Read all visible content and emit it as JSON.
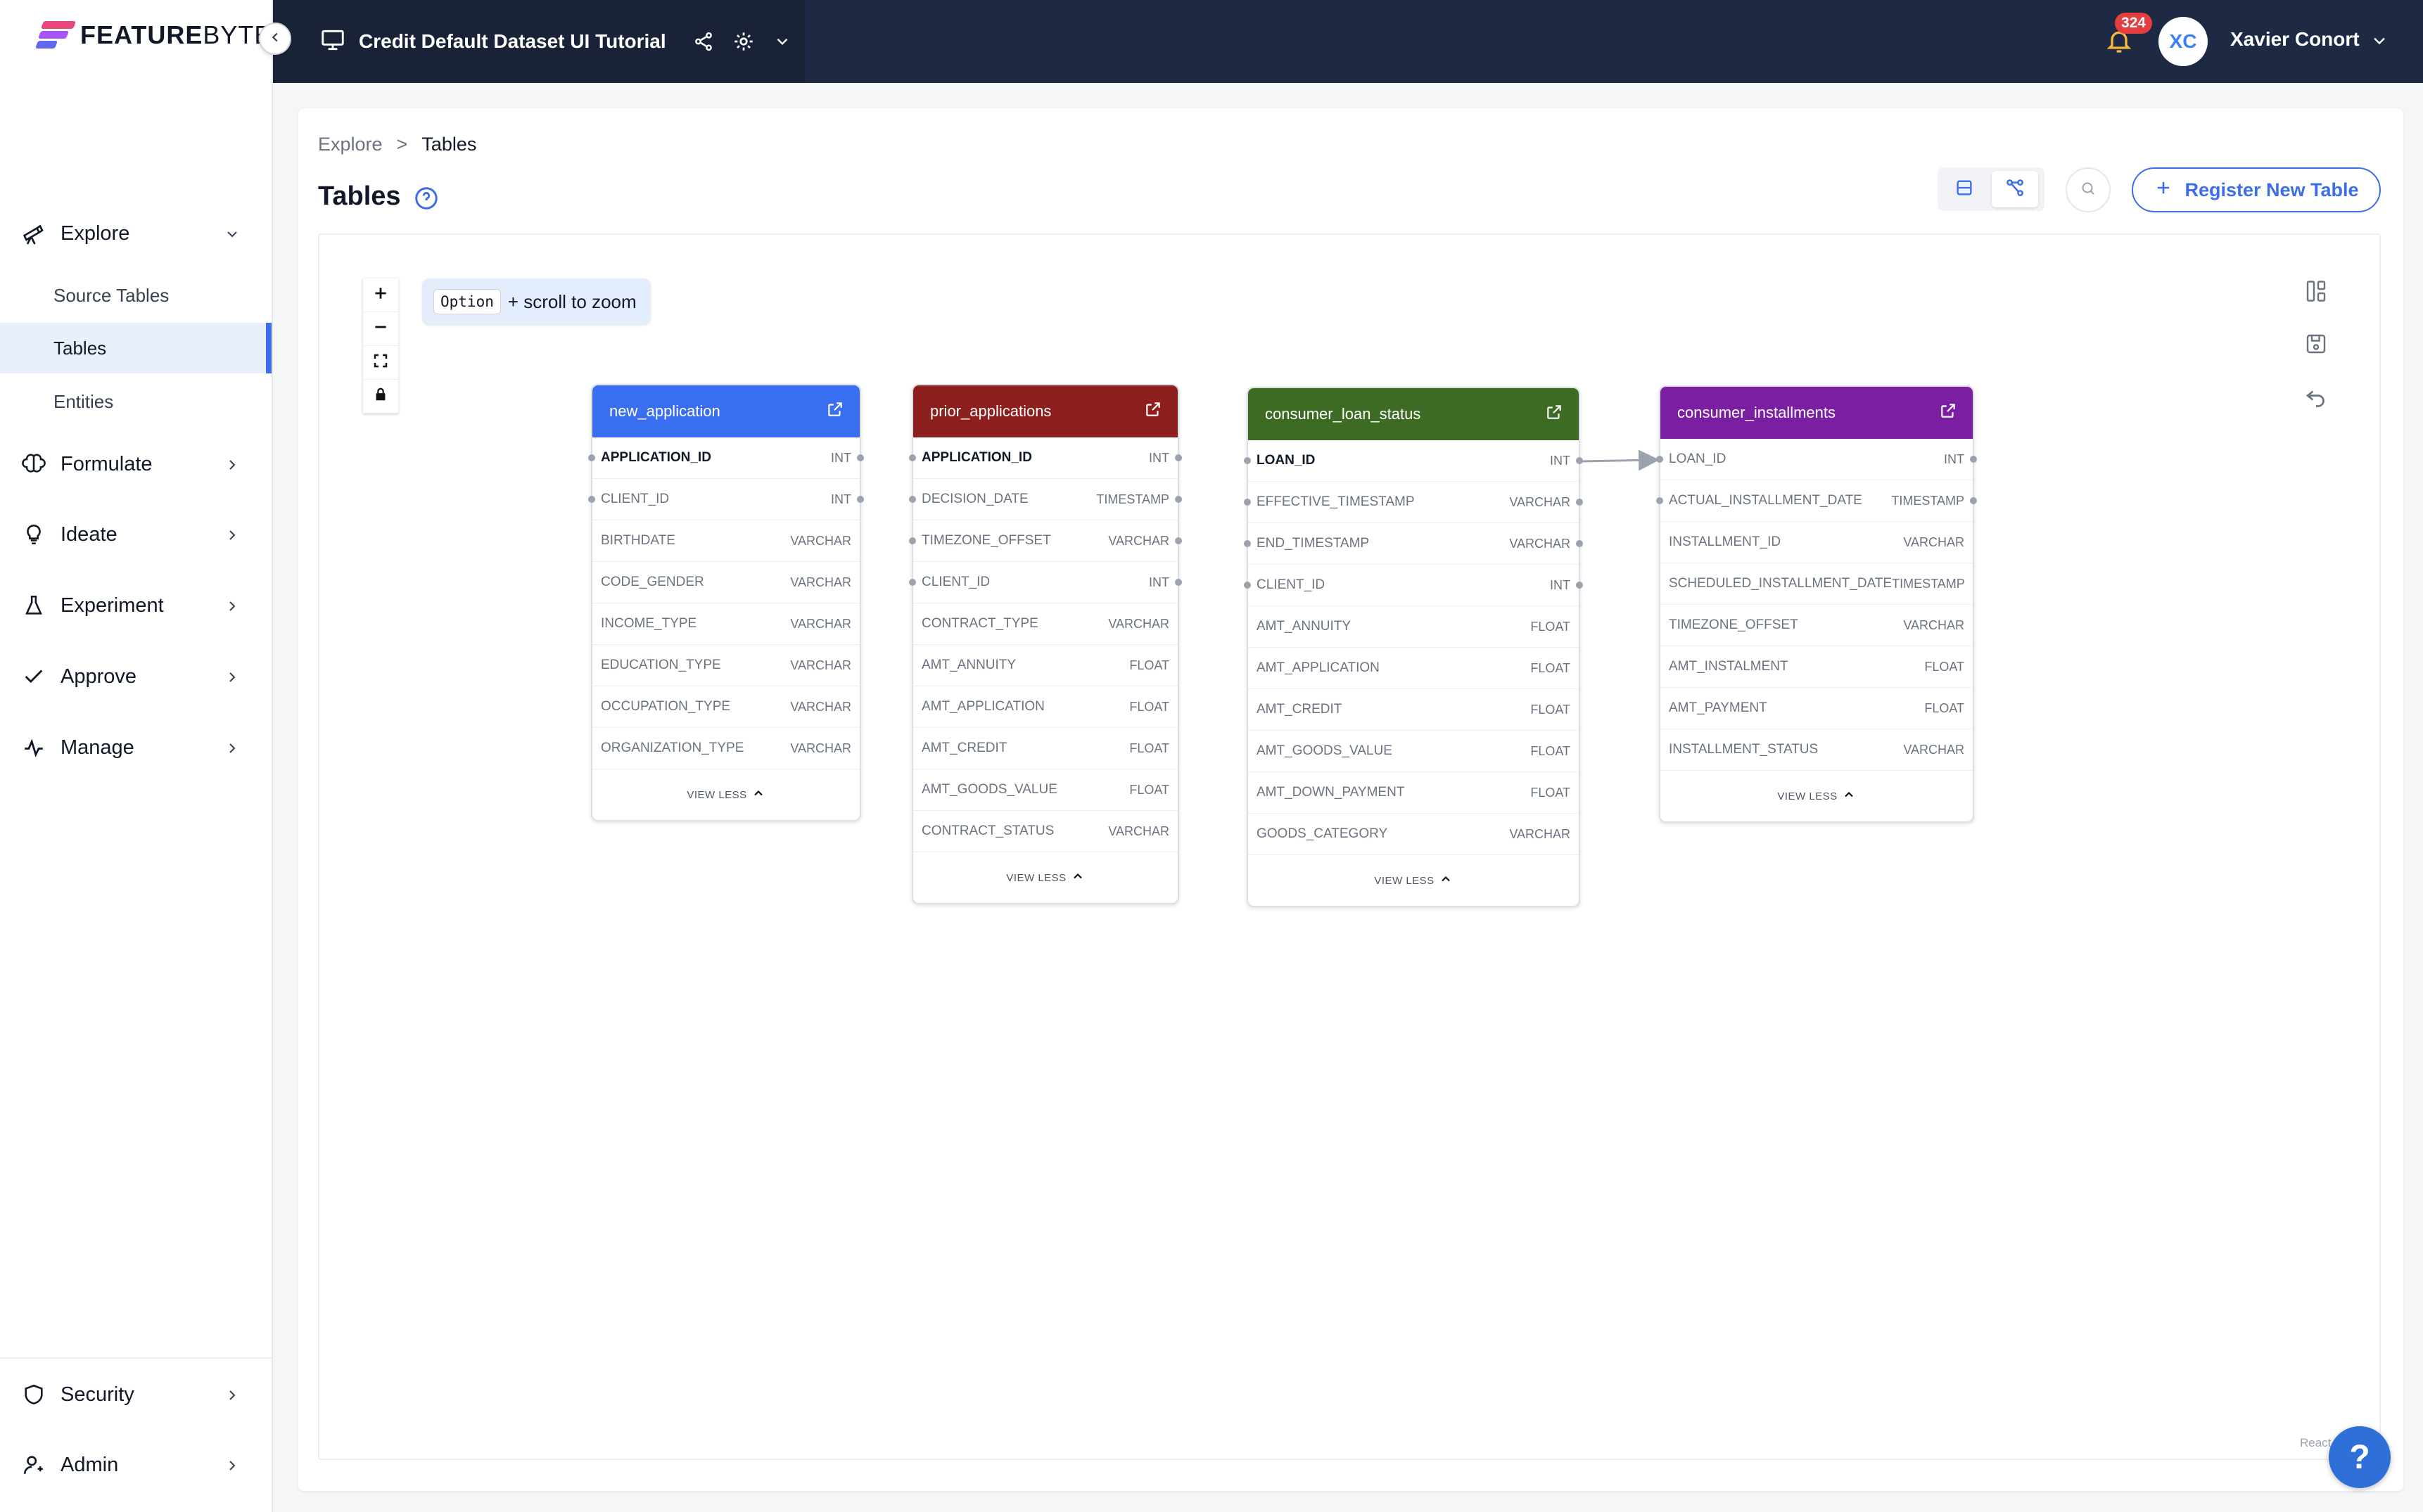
{
  "brand": {
    "name_bold": "FEATURE",
    "name_light": "BYTE"
  },
  "topbar": {
    "project_title": "Credit Default Dataset UI Tutorial",
    "notification_count": "324",
    "user_initials": "XC",
    "user_name": "Xavier Conort"
  },
  "sidebar": {
    "explore": "Explore",
    "sub_items": [
      "Source Tables",
      "Tables",
      "Entities"
    ],
    "active_sub": "Tables",
    "formulate": "Formulate",
    "ideate": "Ideate",
    "experiment": "Experiment",
    "approve": "Approve",
    "manage": "Manage",
    "security": "Security",
    "admin": "Admin"
  },
  "page": {
    "breadcrumb_root": "Explore",
    "breadcrumb_sep": ">",
    "breadcrumb_current": "Tables",
    "title": "Tables",
    "register_label": "Register New Table"
  },
  "canvas": {
    "zoom_key": "Option",
    "zoom_hint": "+ scroll to zoom",
    "view_less": "VIEW LESS",
    "attribution": "React Flow"
  },
  "tables": [
    {
      "name": "new_application",
      "color": "#3a6ef0",
      "columns": [
        {
          "name": "APPLICATION_ID",
          "type": "INT",
          "key": true,
          "left": true,
          "right": true
        },
        {
          "name": "CLIENT_ID",
          "type": "INT",
          "key": false,
          "left": true,
          "right": true
        },
        {
          "name": "BIRTHDATE",
          "type": "VARCHAR",
          "key": false
        },
        {
          "name": "CODE_GENDER",
          "type": "VARCHAR",
          "key": false
        },
        {
          "name": "INCOME_TYPE",
          "type": "VARCHAR",
          "key": false
        },
        {
          "name": "EDUCATION_TYPE",
          "type": "VARCHAR",
          "key": false
        },
        {
          "name": "OCCUPATION_TYPE",
          "type": "VARCHAR",
          "key": false
        },
        {
          "name": "ORGANIZATION_TYPE",
          "type": "VARCHAR",
          "key": false
        }
      ]
    },
    {
      "name": "prior_applications",
      "color": "#8e1f1f",
      "columns": [
        {
          "name": "APPLICATION_ID",
          "type": "INT",
          "key": true,
          "left": true,
          "right": true
        },
        {
          "name": "DECISION_DATE",
          "type": "TIMESTAMP",
          "key": false,
          "left": true,
          "right": true
        },
        {
          "name": "TIMEZONE_OFFSET",
          "type": "VARCHAR",
          "key": false,
          "left": true,
          "right": true
        },
        {
          "name": "CLIENT_ID",
          "type": "INT",
          "key": false,
          "left": true,
          "right": true
        },
        {
          "name": "CONTRACT_TYPE",
          "type": "VARCHAR",
          "key": false
        },
        {
          "name": "AMT_ANNUITY",
          "type": "FLOAT",
          "key": false
        },
        {
          "name": "AMT_APPLICATION",
          "type": "FLOAT",
          "key": false
        },
        {
          "name": "AMT_CREDIT",
          "type": "FLOAT",
          "key": false
        },
        {
          "name": "AMT_GOODS_VALUE",
          "type": "FLOAT",
          "key": false
        },
        {
          "name": "CONTRACT_STATUS",
          "type": "VARCHAR",
          "key": false
        }
      ]
    },
    {
      "name": "consumer_loan_status",
      "color": "#3d6b24",
      "columns": [
        {
          "name": "LOAN_ID",
          "type": "INT",
          "key": true,
          "left": true,
          "right": true
        },
        {
          "name": "EFFECTIVE_TIMESTAMP",
          "type": "VARCHAR",
          "key": false,
          "left": true,
          "right": true
        },
        {
          "name": "END_TIMESTAMP",
          "type": "VARCHAR",
          "key": false,
          "left": true,
          "right": true
        },
        {
          "name": "CLIENT_ID",
          "type": "INT",
          "key": false,
          "left": true,
          "right": true
        },
        {
          "name": "AMT_ANNUITY",
          "type": "FLOAT",
          "key": false
        },
        {
          "name": "AMT_APPLICATION",
          "type": "FLOAT",
          "key": false
        },
        {
          "name": "AMT_CREDIT",
          "type": "FLOAT",
          "key": false
        },
        {
          "name": "AMT_GOODS_VALUE",
          "type": "FLOAT",
          "key": false
        },
        {
          "name": "AMT_DOWN_PAYMENT",
          "type": "FLOAT",
          "key": false
        },
        {
          "name": "GOODS_CATEGORY",
          "type": "VARCHAR",
          "key": false
        }
      ]
    },
    {
      "name": "consumer_installments",
      "color": "#7b1fa2",
      "columns": [
        {
          "name": "LOAN_ID",
          "type": "INT",
          "key": false,
          "left": true,
          "right": true
        },
        {
          "name": "ACTUAL_INSTALLMENT_DATE",
          "type": "TIMESTAMP",
          "key": false,
          "left": true,
          "right": true
        },
        {
          "name": "INSTALLMENT_ID",
          "type": "VARCHAR",
          "key": false
        },
        {
          "name": "SCHEDULED_INSTALLMENT_DATE",
          "type": "TIMESTAMP",
          "key": false
        },
        {
          "name": "TIMEZONE_OFFSET",
          "type": "VARCHAR",
          "key": false
        },
        {
          "name": "AMT_INSTALMENT",
          "type": "FLOAT",
          "key": false
        },
        {
          "name": "AMT_PAYMENT",
          "type": "FLOAT",
          "key": false
        },
        {
          "name": "INSTALLMENT_STATUS",
          "type": "VARCHAR",
          "key": false
        }
      ]
    }
  ]
}
